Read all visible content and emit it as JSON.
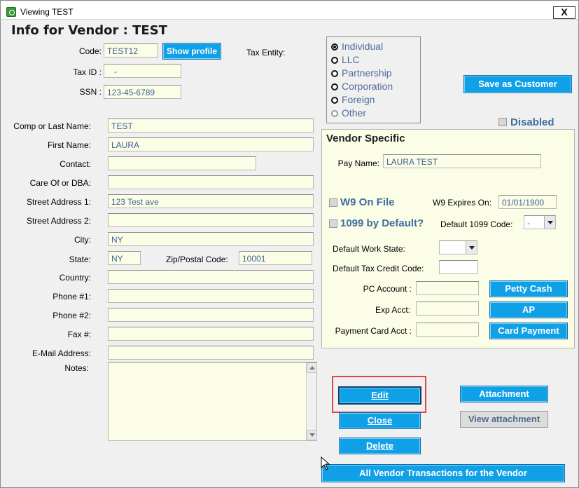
{
  "window": {
    "title": "Viewing TEST",
    "close_glyph": "X"
  },
  "header": {
    "title": "Info for Vendor : TEST"
  },
  "top_fields": {
    "code_label": "Code:",
    "code_value": "TEST12",
    "show_profile_label": "Show profile",
    "tax_id_label": "Tax ID :",
    "tax_id_value": "-",
    "ssn_label": "SSN :",
    "ssn_value": "123-45-6789",
    "tax_entity_label": "Tax Entity:"
  },
  "tax_entity": {
    "options": [
      {
        "label": "Individual",
        "selected": true
      },
      {
        "label": "LLC",
        "selected": false
      },
      {
        "label": "Partnership",
        "selected": false
      },
      {
        "label": "Corporation",
        "selected": false
      },
      {
        "label": "Foreign",
        "selected": false
      },
      {
        "label": "Other",
        "selected": false
      }
    ]
  },
  "save_as_customer_label": "Save as Customer",
  "disabled_label": "Disabled",
  "vendor_form": {
    "comp_last_name_label": "Comp or Last Name:",
    "comp_last_name_value": "TEST",
    "first_name_label": "First Name:",
    "first_name_value": "LAURA",
    "contact_label": "Contact:",
    "contact_value": "",
    "care_of_label": "Care Of or DBA:",
    "care_of_value": "",
    "street1_label": "Street Address 1:",
    "street1_value": "123 Test ave",
    "street2_label": "Street Address 2:",
    "street2_value": "",
    "city_label": "City:",
    "city_value": "NY",
    "state_label": "State:",
    "state_value": "NY",
    "zip_label": "Zip/Postal Code:",
    "zip_value": "10001",
    "country_label": "Country:",
    "country_value": "",
    "phone1_label": "Phone #1:",
    "phone1_value": "",
    "phone2_label": "Phone #2:",
    "phone2_value": "",
    "fax_label": "Fax #:",
    "fax_value": "",
    "email_label": "E-Mail Address:",
    "email_value": "",
    "notes_label": "Notes:",
    "notes_value": ""
  },
  "vendor_specific": {
    "title": "Vendor Specific",
    "pay_name_label": "Pay Name:",
    "pay_name_value": "LAURA TEST",
    "w9_label": "W9 On File",
    "w9_expires_label": "W9 Expires On:",
    "w9_expires_value": "01/01/1900",
    "default_1099_check_label": "1099 by Default?",
    "default_1099_code_label": "Default 1099 Code:",
    "default_1099_code_value": "-",
    "work_state_label": "Default Work State:",
    "work_state_value": "",
    "tax_credit_label": "Default Tax Credit Code:",
    "tax_credit_value": "",
    "pc_account_label": "PC Account :",
    "pc_account_value": "",
    "exp_acct_label": "Exp Acct:",
    "exp_acct_value": "",
    "payment_card_label": "Payment Card Acct :",
    "payment_card_value": "",
    "petty_cash_label": "Petty Cash",
    "ap_label": "AP",
    "card_payment_label": "Card Payment"
  },
  "actions": {
    "edit_label": "Edit",
    "close_label": "Close",
    "delete_label": "Delete",
    "attachment_label": "Attachment",
    "view_attachment_label": "View attachment",
    "all_transactions_label": "All  Vendor Transactions for the Vendor"
  },
  "colors": {
    "accent_button": "#0fa0e8",
    "field_bg": "#fbfde6",
    "field_text": "#3f6296",
    "highlight": "#e04646"
  }
}
